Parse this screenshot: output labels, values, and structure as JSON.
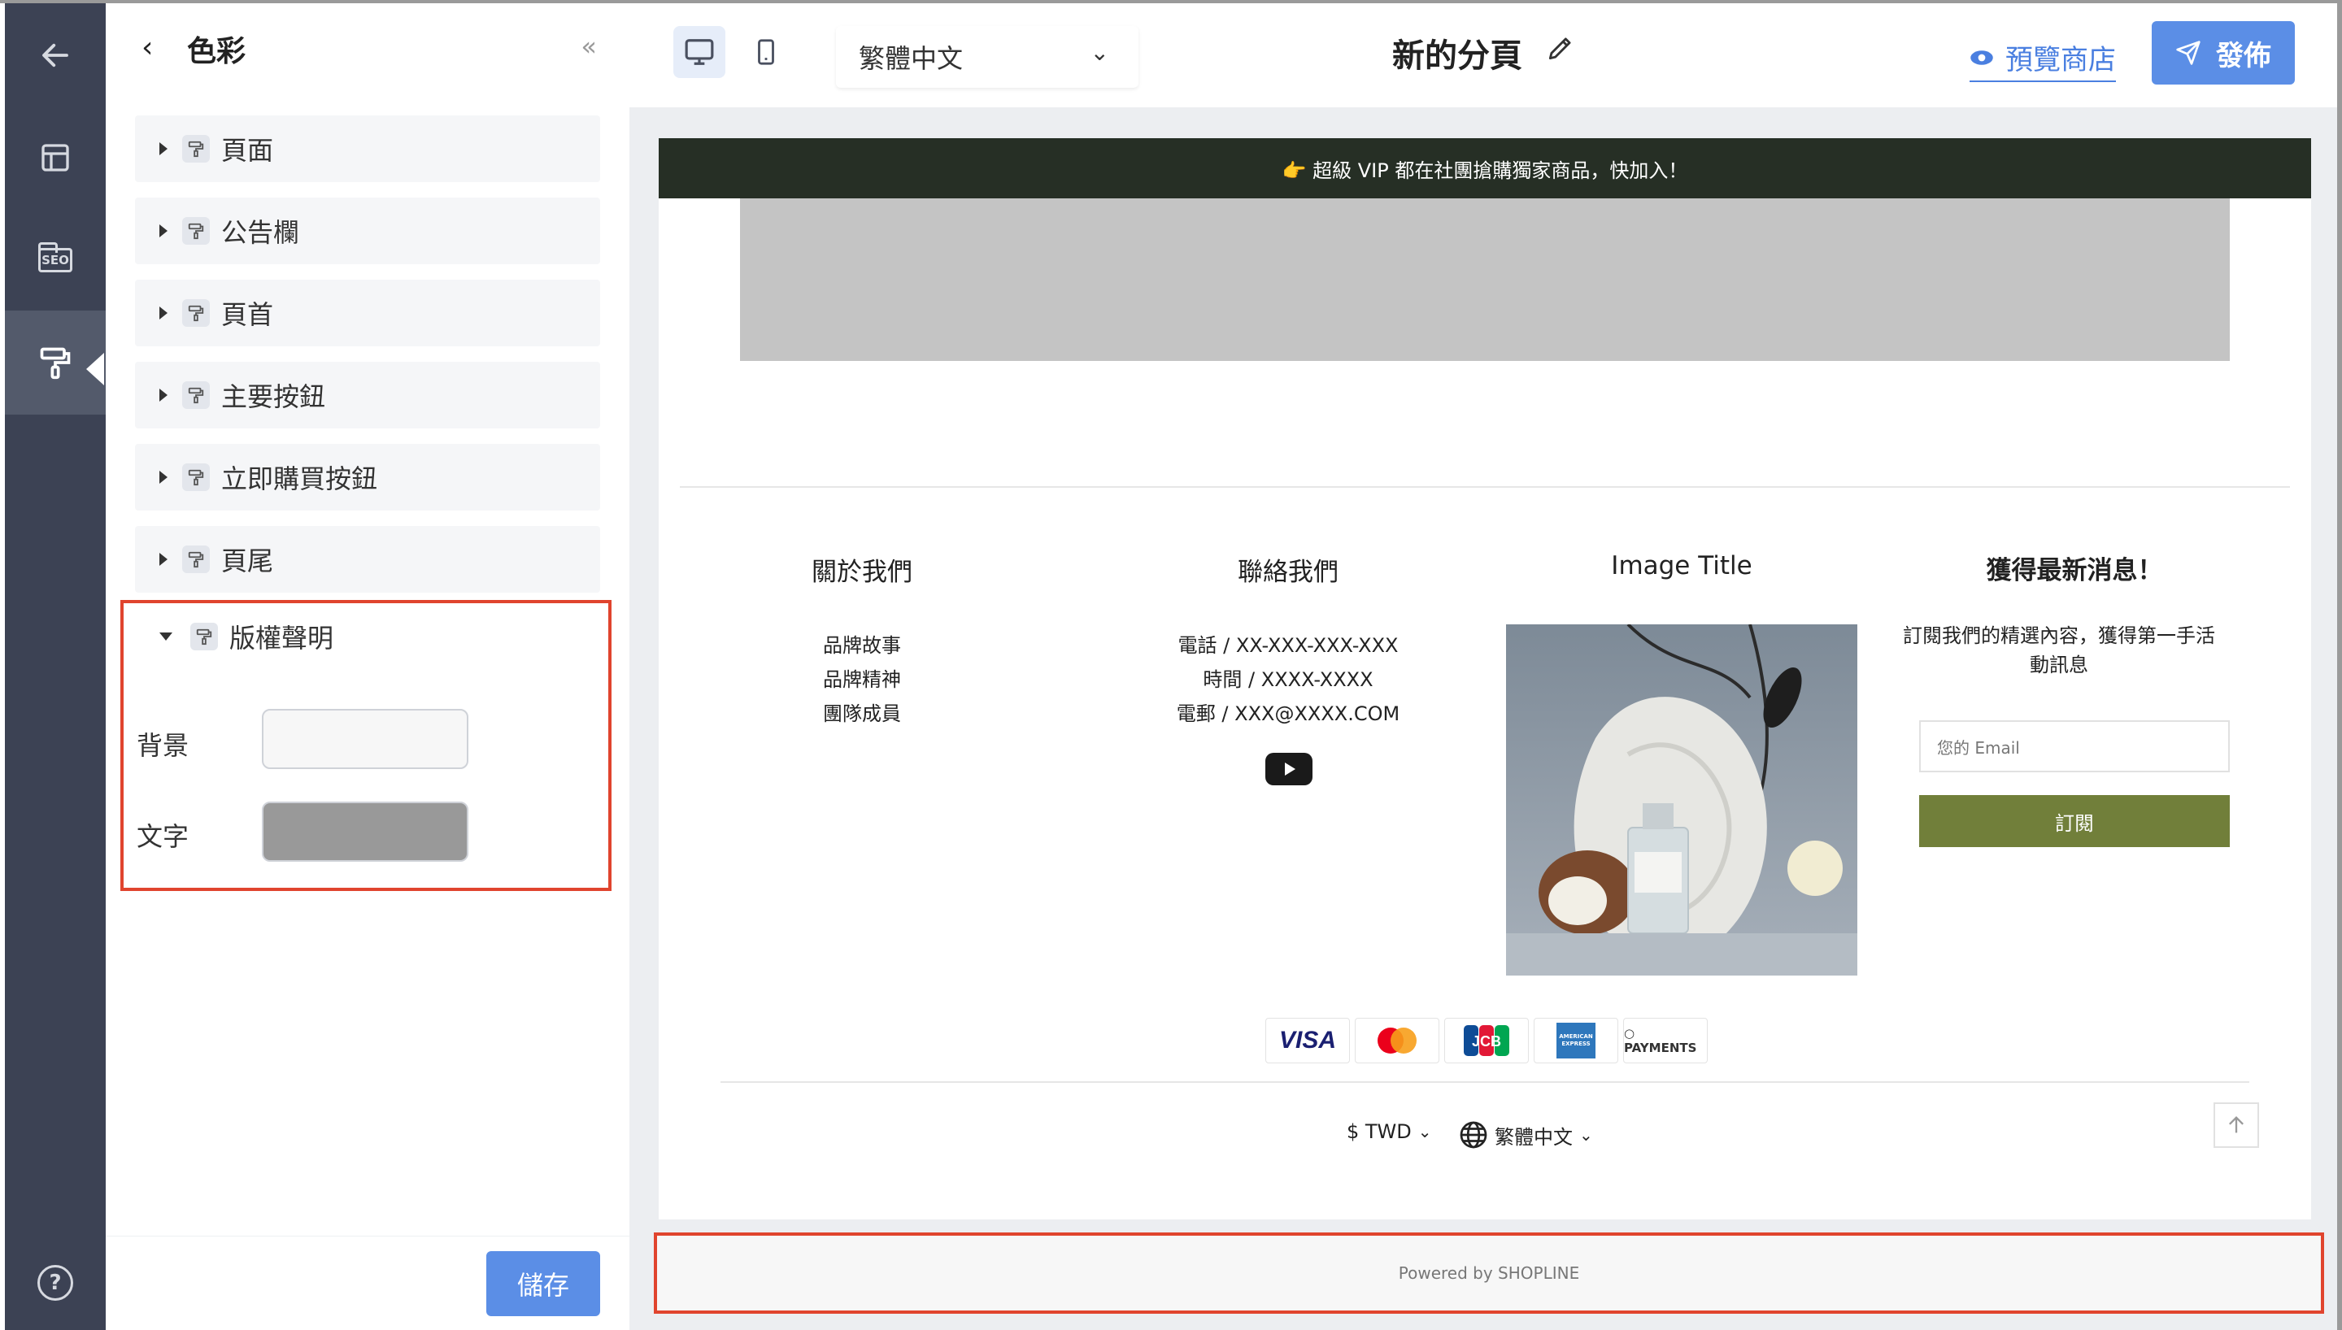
{
  "rail": {
    "items": [
      "back-arrow",
      "layout-icon",
      "seo-icon",
      "paint-roller-icon"
    ],
    "seo_label": "SEO",
    "help_label": "?"
  },
  "panel": {
    "back_label": "‹",
    "title": "色彩",
    "collapse_label": "«",
    "sections": [
      {
        "label": "頁面"
      },
      {
        "label": "公告欄"
      },
      {
        "label": "頁首"
      },
      {
        "label": "主要按鈕"
      },
      {
        "label": "立即購買按鈕"
      },
      {
        "label": "頁尾"
      }
    ],
    "expanded": {
      "label": "版權聲明",
      "fields": [
        {
          "label": "背景",
          "color": "#f7f7f7"
        },
        {
          "label": "文字",
          "color": "#999999"
        }
      ]
    },
    "save_label": "儲存"
  },
  "topbar": {
    "language": "繁體中文",
    "page_title": "新的分頁",
    "preview_label": "預覽商店",
    "publish_label": "發佈"
  },
  "shop": {
    "announcement": "👉 超級 VIP 都在社團搶購獨家商品，快加入！",
    "footer": {
      "about_title": "關於我們",
      "about_items": [
        "品牌故事",
        "品牌精神",
        "團隊成員"
      ],
      "contact_title": "聯絡我們",
      "contact_items": [
        "電話 / XX-XXX-XXX-XXX",
        "時間 / XXXX-XXXX",
        "電郵 / XXX@XXXX.COM"
      ],
      "image_title": "Image Title",
      "newsletter_title": "獲得最新消息！",
      "newsletter_text": "訂閱我們的精選內容，獲得第一手活動訊息",
      "email_placeholder": "您的 Email",
      "subscribe_label": "訂閱"
    },
    "payments": [
      "VISA",
      "Mastercard",
      "JCB",
      "AMERICAN EXPRESS",
      "PAYMENTS"
    ],
    "currency": "$ TWD",
    "language": "繁體中文",
    "copyright": "Powered by SHOPLINE"
  },
  "colors": {
    "rail_bg": "#3c4254",
    "accent": "#5b8ee6",
    "highlight": "#e0442e",
    "announcement_bg": "#262f25",
    "subscribe_bg": "#717f3a"
  }
}
